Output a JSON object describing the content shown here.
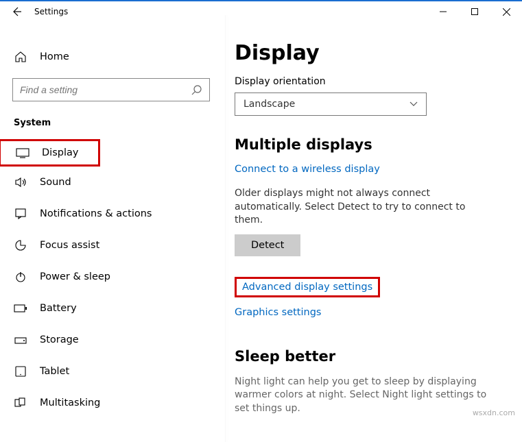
{
  "window": {
    "title": "Settings"
  },
  "sidebar": {
    "home": "Home",
    "search_placeholder": "Find a setting",
    "section": "System",
    "items": [
      {
        "label": "Display"
      },
      {
        "label": "Sound"
      },
      {
        "label": "Notifications & actions"
      },
      {
        "label": "Focus assist"
      },
      {
        "label": "Power & sleep"
      },
      {
        "label": "Battery"
      },
      {
        "label": "Storage"
      },
      {
        "label": "Tablet"
      },
      {
        "label": "Multitasking"
      }
    ]
  },
  "main": {
    "title": "Display",
    "orientation_label": "Display orientation",
    "orientation_value": "Landscape",
    "multi_heading": "Multiple displays",
    "wireless_link": "Connect to a wireless display",
    "older_text": "Older displays might not always connect automatically. Select Detect to try to connect to them.",
    "detect_btn": "Detect",
    "advanced_link": "Advanced display settings",
    "graphics_link": "Graphics settings",
    "sleep_heading": "Sleep better",
    "sleep_text": "Night light can help you get to sleep by displaying warmer colors at night. Select Night light settings to set things up."
  },
  "watermark": "wsxdn.com"
}
